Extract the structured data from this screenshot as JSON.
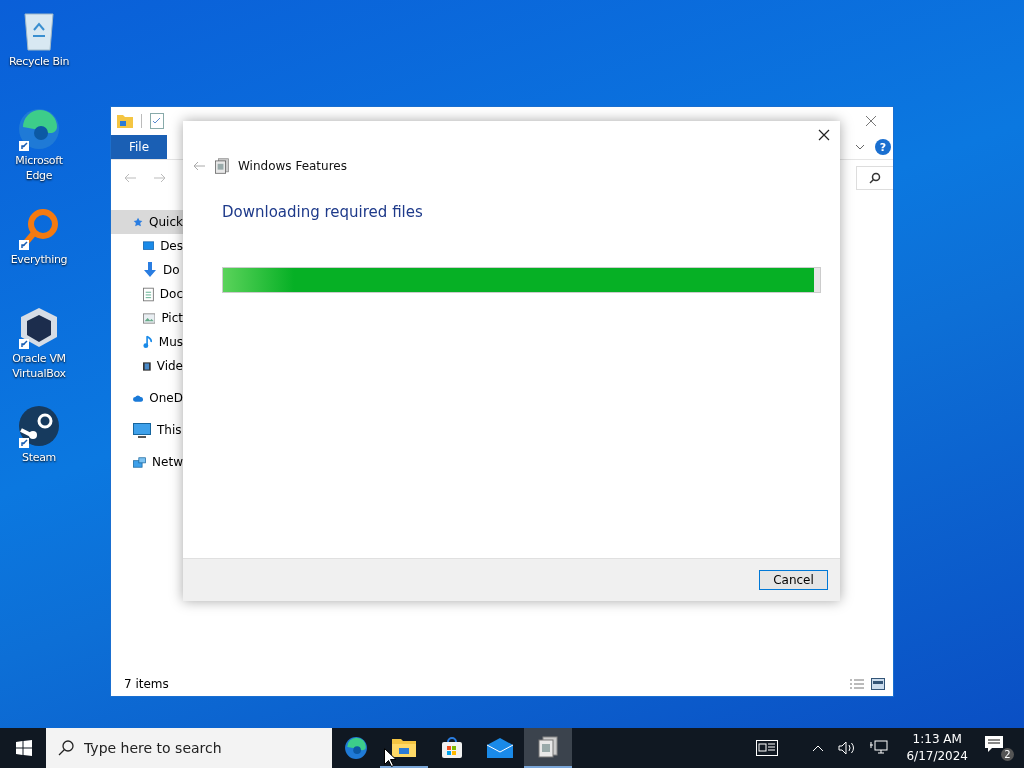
{
  "desktop_icons": [
    {
      "kind": "recycle",
      "label": "Recycle Bin",
      "shortcut": false
    },
    {
      "kind": "edge",
      "label": "Microsoft Edge",
      "shortcut": true
    },
    {
      "kind": "everything",
      "label": "Everything",
      "shortcut": true
    },
    {
      "kind": "virtualbox",
      "label": "Oracle VM VirtualBox",
      "shortcut": true
    },
    {
      "kind": "steam",
      "label": "Steam",
      "shortcut": true
    }
  ],
  "explorer": {
    "ribbon_tab": "File",
    "help": "?",
    "sidebar": [
      {
        "kind": "star",
        "label": "Quick",
        "selected": true
      },
      {
        "kind": "desktop",
        "label": "Des",
        "selected": false
      },
      {
        "kind": "download",
        "label": "Do",
        "selected": false
      },
      {
        "kind": "document",
        "label": "Doc",
        "selected": false
      },
      {
        "kind": "picture",
        "label": "Pict",
        "selected": false
      },
      {
        "kind": "music",
        "label": "Mus",
        "selected": false
      },
      {
        "kind": "video",
        "label": "Vide",
        "selected": false
      },
      {
        "kind": "cloud",
        "label": "OneD",
        "selected": false
      },
      {
        "kind": "pc",
        "label": "This",
        "selected": false
      },
      {
        "kind": "network",
        "label": "Netw",
        "selected": false
      }
    ],
    "status": "7 items"
  },
  "dialog": {
    "title": "Windows Features",
    "heading": "Downloading required files",
    "progress": {
      "level": 0.99
    },
    "buttons": [
      "Cancel"
    ]
  },
  "taskbar": {
    "search": {
      "placeholder": "Type here to search"
    },
    "apps": [
      {
        "kind": "edge",
        "running": false,
        "selected": false
      },
      {
        "kind": "folder",
        "running": true,
        "selected": false
      },
      {
        "kind": "store",
        "running": false,
        "selected": false
      },
      {
        "kind": "mail",
        "running": false,
        "selected": false
      },
      {
        "kind": "features",
        "running": true,
        "selected": true
      }
    ],
    "time": "1:13 AM",
    "date": "6/17/2024",
    "notifications": "2"
  }
}
